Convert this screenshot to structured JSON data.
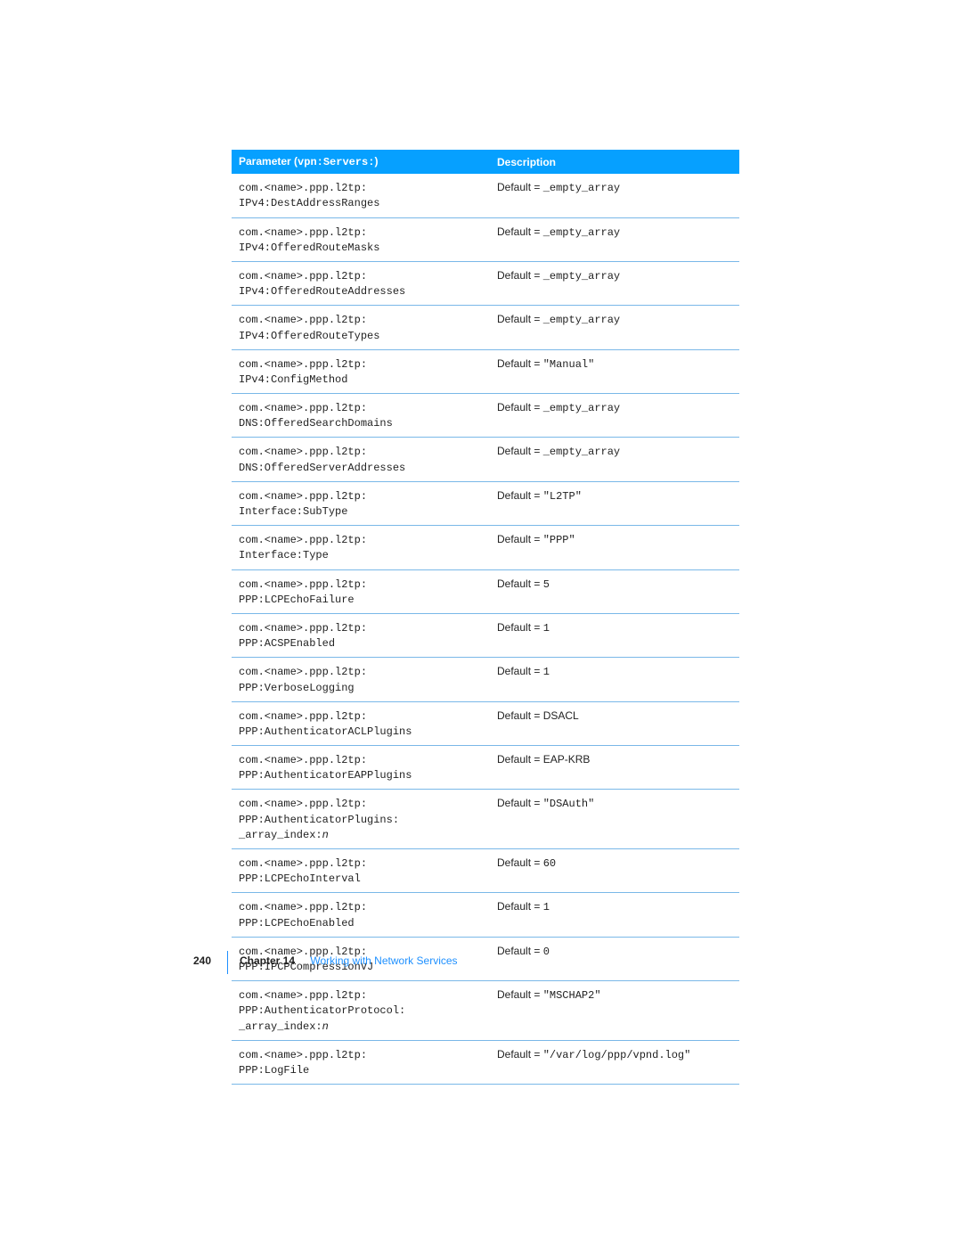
{
  "header": {
    "param_label_prefix": "Parameter (",
    "param_label_code": "vpn:Servers:",
    "param_label_suffix": ")",
    "desc_label": "Description"
  },
  "default_prefix": "Default = ",
  "rows": [
    {
      "param": "com.<name>.ppp.l2tp:\nIPv4:DestAddressRanges",
      "desc_code": "_empty_array"
    },
    {
      "param": "com.<name>.ppp.l2tp:\nIPv4:OfferedRouteMasks",
      "desc_code": "_empty_array"
    },
    {
      "param": "com.<name>.ppp.l2tp:\nIPv4:OfferedRouteAddresses",
      "desc_code": "_empty_array"
    },
    {
      "param": "com.<name>.ppp.l2tp:\nIPv4:OfferedRouteTypes",
      "desc_code": "_empty_array"
    },
    {
      "param": "com.<name>.ppp.l2tp:\nIPv4:ConfigMethod",
      "desc_code": "\"Manual\""
    },
    {
      "param": "com.<name>.ppp.l2tp:\nDNS:OfferedSearchDomains",
      "desc_code": "_empty_array"
    },
    {
      "param": "com.<name>.ppp.l2tp:\nDNS:OfferedServerAddresses",
      "desc_code": "_empty_array"
    },
    {
      "param": "com.<name>.ppp.l2tp:\nInterface:SubType",
      "desc_code": "\"L2TP\""
    },
    {
      "param": "com.<name>.ppp.l2tp:\nInterface:Type",
      "desc_code": "\"PPP\""
    },
    {
      "param": "com.<name>.ppp.l2tp:\nPPP:LCPEchoFailure",
      "desc_code": "5"
    },
    {
      "param": "com.<name>.ppp.l2tp:\nPPP:ACSPEnabled",
      "desc_code": "1"
    },
    {
      "param": "com.<name>.ppp.l2tp:\nPPP:VerboseLogging",
      "desc_code": "1"
    },
    {
      "param": "com.<name>.ppp.l2tp:\nPPP:AuthenticatorACLPlugins",
      "desc_plain": "DSACL"
    },
    {
      "param": "com.<name>.ppp.l2tp:\nPPP:AuthenticatorEAPPlugins",
      "desc_plain": "EAP-KRB"
    },
    {
      "param": "com.<name>.ppp.l2tp:\nPPP:AuthenticatorPlugins:\n_array_index:",
      "param_tail_italic": "n",
      "desc_code": "\"DSAuth\""
    },
    {
      "param": "com.<name>.ppp.l2tp:\nPPP:LCPEchoInterval",
      "desc_code": "60"
    },
    {
      "param": "com.<name>.ppp.l2tp:\nPPP:LCPEchoEnabled",
      "desc_code": "1"
    },
    {
      "param": "com.<name>.ppp.l2tp:\nPPP:IPCPCompressionVJ",
      "desc_code": "0"
    },
    {
      "param": "com.<name>.ppp.l2tp:\nPPP:AuthenticatorProtocol:\n_array_index:",
      "param_tail_italic": "n",
      "desc_code": "\"MSCHAP2\""
    },
    {
      "param": "com.<name>.ppp.l2tp:\nPPP:LogFile",
      "desc_code": "\"/var/log/ppp/vpnd.log\""
    }
  ],
  "footer": {
    "page_number": "240",
    "chapter_label": "Chapter 14",
    "chapter_title": "Working with Network Services"
  }
}
